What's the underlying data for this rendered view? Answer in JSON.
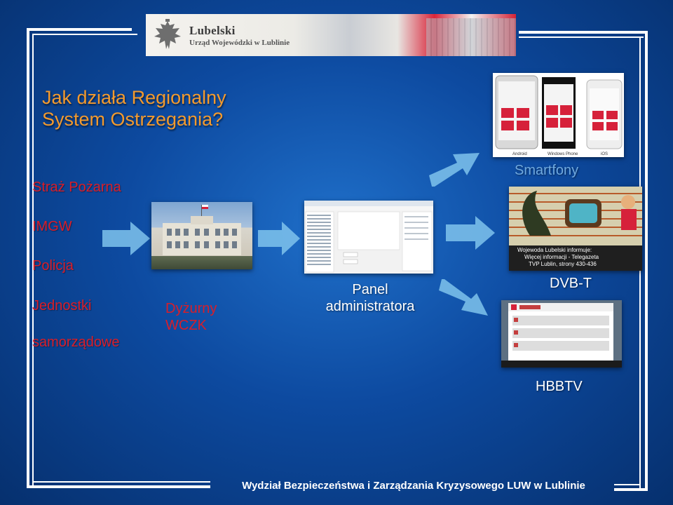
{
  "header": {
    "title": "Lubelski",
    "subtitle": "Urząd Wojewódzki w Lublinie"
  },
  "slide": {
    "title": "Jak działa Regionalny System Ostrzegania?"
  },
  "sources": [
    "Straż Pożarna",
    "IMGW",
    "Policja",
    "Jednostki",
    "samorządowe"
  ],
  "nodes": {
    "dispatcher": "Dyżurny WCZK",
    "admin_panel": "Panel administratora",
    "smartphones": "Smartfony",
    "dvbt": "DVB-T",
    "hbbtv": "HBBTV"
  },
  "phone_labels": [
    "Android",
    "Windows Phone",
    "iOS"
  ],
  "tv_caption_lines": [
    "Wojewoda Lubelski informuje:",
    "Więcej informacji - Telegazeta",
    "TVP Lublin, strony 430-436"
  ],
  "footer": {
    "text": "Wydział Bezpieczeństwa i Zarządzania Kryzysowego LUW w Lublinie"
  },
  "colors": {
    "title": "#f39a2e",
    "source_text": "#d81e2a",
    "arrow": "#7fc3ec",
    "background": "#0d4aa0"
  }
}
